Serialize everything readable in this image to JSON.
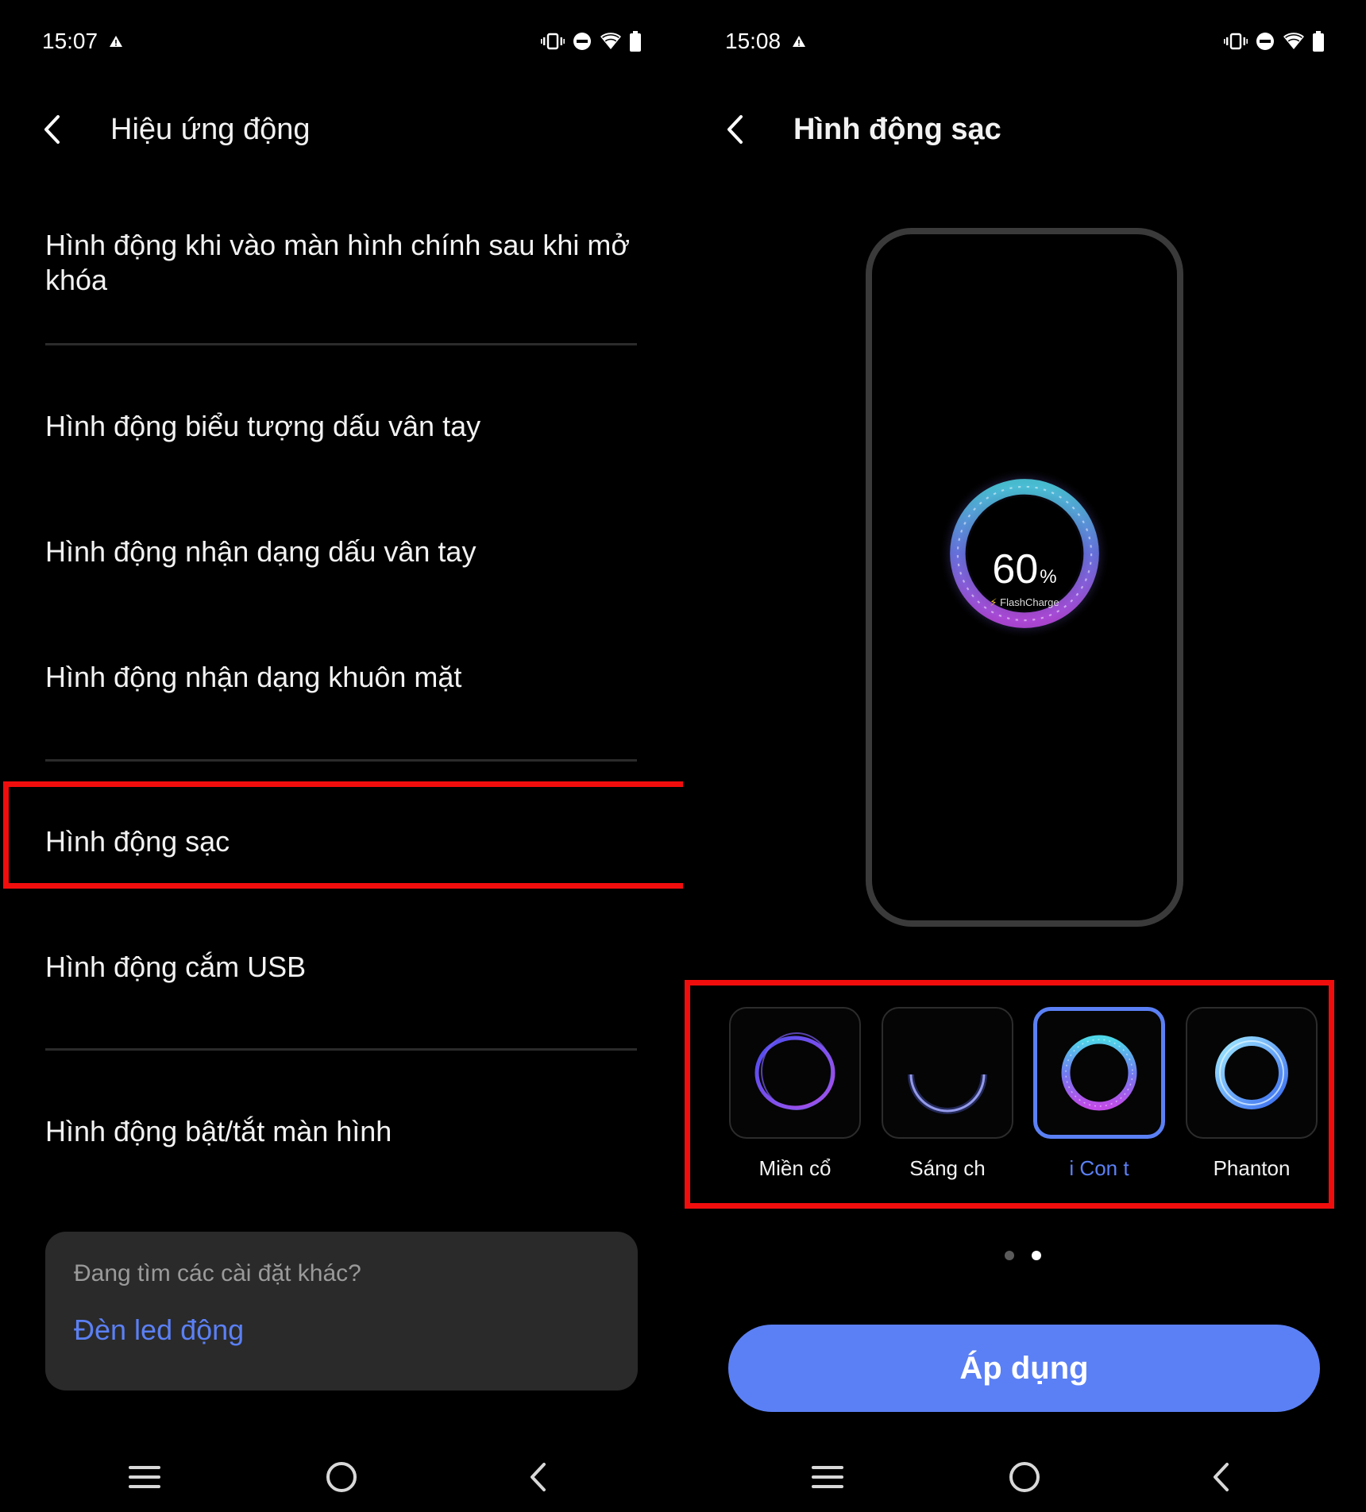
{
  "left": {
    "status": {
      "time": "15:07"
    },
    "header": {
      "title": "Hiệu ứng động"
    },
    "menu": [
      {
        "label": "Hình động khi vào màn hình chính sau khi mở khóa"
      },
      {
        "label": "Hình động biểu tượng dấu vân tay"
      },
      {
        "label": "Hình động nhận dạng dấu vân tay"
      },
      {
        "label": "Hình động nhận dạng khuôn mặt"
      },
      {
        "label": "Hình động sạc"
      },
      {
        "label": "Hình động cắm USB"
      },
      {
        "label": "Hình động bật/tắt màn hình"
      }
    ],
    "card": {
      "question": "Đang tìm các cài đặt khác?",
      "link": "Đèn led động"
    }
  },
  "right": {
    "status": {
      "time": "15:08"
    },
    "header": {
      "title": "Hình động sạc"
    },
    "preview": {
      "percent": "60",
      "percent_unit": "%",
      "charge_label": "FlashCharge"
    },
    "options": [
      {
        "label": "Miền cổ",
        "selected": false
      },
      {
        "label": "Sáng ch",
        "selected": false
      },
      {
        "label": "i    Con t",
        "selected": true
      },
      {
        "label": "Phanton",
        "selected": false
      }
    ],
    "page_indicator": {
      "total": 2,
      "current": 2
    },
    "apply_label": "Áp dụng"
  },
  "colors": {
    "accent": "#5b80f5",
    "highlight": "#f20d0d",
    "background": "#000000",
    "card": "#2a2a2a"
  }
}
